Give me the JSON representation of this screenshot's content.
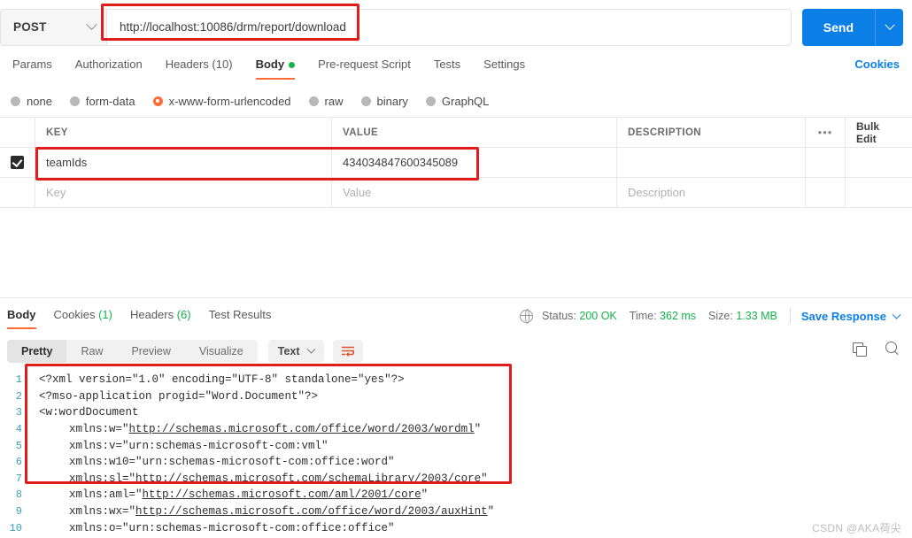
{
  "request": {
    "method": "POST",
    "url": "http://localhost:10086/drm/report/download",
    "send_label": "Send",
    "cookies_label": "Cookies",
    "tabs": [
      {
        "label": "Params",
        "active": false
      },
      {
        "label": "Authorization",
        "active": false
      },
      {
        "label": "Headers (10)",
        "active": false
      },
      {
        "label": "Body",
        "active": true,
        "dot": true
      },
      {
        "label": "Pre-request Script",
        "active": false
      },
      {
        "label": "Tests",
        "active": false
      },
      {
        "label": "Settings",
        "active": false
      }
    ],
    "body_types": [
      {
        "label": "none",
        "selected": false
      },
      {
        "label": "form-data",
        "selected": false
      },
      {
        "label": "x-www-form-urlencoded",
        "selected": true
      },
      {
        "label": "raw",
        "selected": false
      },
      {
        "label": "binary",
        "selected": false
      },
      {
        "label": "GraphQL",
        "selected": false
      }
    ],
    "table": {
      "headers": [
        "KEY",
        "VALUE",
        "DESCRIPTION"
      ],
      "dots_label": "•••",
      "bulk_edit_label": "Bulk Edit",
      "rows": [
        {
          "checked": true,
          "key": "teamIds",
          "value": "434034847600345089",
          "description": ""
        }
      ],
      "placeholders": {
        "key": "Key",
        "value": "Value",
        "description": "Description"
      }
    }
  },
  "response": {
    "tabs": [
      {
        "label": "Body",
        "count": "",
        "active": true
      },
      {
        "label": "Cookies",
        "count": " (1)",
        "active": false
      },
      {
        "label": "Headers",
        "count": " (6)",
        "active": false
      },
      {
        "label": "Test Results",
        "count": "",
        "active": false
      }
    ],
    "status_label": "Status:",
    "status_value": "200 OK",
    "time_label": "Time:",
    "time_value": "362 ms",
    "size_label": "Size:",
    "size_value": "1.33 MB",
    "save_response_label": "Save Response",
    "view_modes": [
      {
        "label": "Pretty",
        "active": true
      },
      {
        "label": "Raw",
        "active": false
      },
      {
        "label": "Preview",
        "active": false
      },
      {
        "label": "Visualize",
        "active": false
      }
    ],
    "format_label": "Text",
    "code_lines": [
      {
        "n": "1",
        "indent": 0,
        "parts": [
          {
            "t": "<?xml version=\"1.0\" encoding=\"UTF-8\" standalone=\"yes\"?>",
            "u": false
          }
        ]
      },
      {
        "n": "2",
        "indent": 0,
        "parts": [
          {
            "t": "<?mso-application progid=\"Word.Document\"?>",
            "u": false
          }
        ]
      },
      {
        "n": "3",
        "indent": 0,
        "parts": [
          {
            "t": "<w:wordDocument",
            "u": false
          }
        ]
      },
      {
        "n": "4",
        "indent": 1,
        "parts": [
          {
            "t": "xmlns:w=\"",
            "u": false
          },
          {
            "t": "http://schemas.microsoft.com/office/word/2003/wordml",
            "u": true
          },
          {
            "t": "\"",
            "u": false
          }
        ]
      },
      {
        "n": "5",
        "indent": 1,
        "parts": [
          {
            "t": "xmlns:v=\"urn:schemas-microsoft-com:vml\"",
            "u": false
          }
        ]
      },
      {
        "n": "6",
        "indent": 1,
        "parts": [
          {
            "t": "xmlns:w10=\"urn:schemas-microsoft-com:office:word\"",
            "u": false
          }
        ]
      },
      {
        "n": "7",
        "indent": 1,
        "parts": [
          {
            "t": "xmlns:sl=\"",
            "u": false
          },
          {
            "t": "http://schemas.microsoft.com/schemaLibrary/2003/core",
            "u": true
          },
          {
            "t": "\"",
            "u": false
          }
        ]
      },
      {
        "n": "8",
        "indent": 1,
        "parts": [
          {
            "t": "xmlns:aml=\"",
            "u": false
          },
          {
            "t": "http://schemas.microsoft.com/aml/2001/core",
            "u": true
          },
          {
            "t": "\"",
            "u": false
          }
        ]
      },
      {
        "n": "9",
        "indent": 1,
        "parts": [
          {
            "t": "xmlns:wx=\"",
            "u": false
          },
          {
            "t": "http://schemas.microsoft.com/office/word/2003/auxHint",
            "u": true
          },
          {
            "t": "\"",
            "u": false
          }
        ]
      },
      {
        "n": "10",
        "indent": 1,
        "parts": [
          {
            "t": "xmlns:o=\"urn:schemas-microsoft-com:office:office\"",
            "u": false
          }
        ]
      }
    ]
  },
  "watermark": "CSDN @AKA荷尖",
  "colors": {
    "accent": "#ff6c37",
    "primary": "#0b7fe6",
    "success": "#15b44a",
    "highlight": "#e21b1b",
    "linenum": "#3aa0b5"
  }
}
